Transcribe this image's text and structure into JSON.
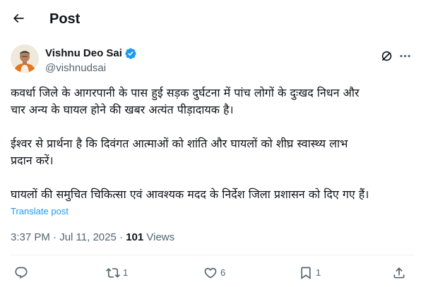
{
  "header": {
    "back_icon": "arrow-left-icon",
    "title": "Post"
  },
  "author": {
    "display_name": "Vishnu Deo Sai",
    "handle": "@vishnudsai",
    "verified": true,
    "verified_color": "#1d9bf0"
  },
  "post": {
    "paragraphs": [
      "कवर्धा जिले के आगरपानी के पास हुई सड़क दुर्घटना में पांच लोगों के दुःखद निधन और\nचार अन्य के घायल होने की खबर अत्यंत पीड़ादायक है।",
      "ईश्वर से प्रार्थना है कि दिवंगत आत्माओं को शांति और घायलों को शीघ्र स्वास्थ्य लाभ\nप्रदान करें।",
      "घायलों की समुचित चिकित्सा एवं आवश्यक मदद के निर्देश जिला प्रशासन को दिए गए हैं।"
    ],
    "translate_label": "Translate post",
    "time": "3:37 PM",
    "separator": "·",
    "date": "Jul 11, 2025",
    "views_count": "101",
    "views_label": "Views"
  },
  "actions": {
    "reply": {
      "icon": "reply-icon",
      "count": ""
    },
    "repost": {
      "icon": "repost-icon",
      "count": "1"
    },
    "like": {
      "icon": "heart-icon",
      "count": "6"
    },
    "bookmark": {
      "icon": "bookmark-icon",
      "count": "1"
    },
    "share": {
      "icon": "share-icon",
      "count": ""
    }
  },
  "colors": {
    "text_primary": "#0f1419",
    "text_secondary": "#536471",
    "accent": "#1d9bf0",
    "divider": "#eff3f4"
  }
}
